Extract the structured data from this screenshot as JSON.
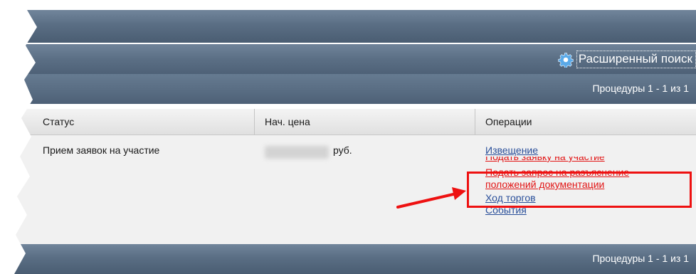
{
  "toolbar": {
    "advanced_search_label": "Расширенный поиск"
  },
  "pager": {
    "top_text": "Процедуры 1 - 1 из 1",
    "bottom_text": "Процедуры 1 - 1 из 1"
  },
  "table": {
    "columns": [
      "Статус",
      "Нач. цена",
      "Операции"
    ],
    "row": {
      "status": "Прием заявок на участие",
      "price_currency": "руб.",
      "operations": {
        "notice": "Извещение",
        "submit_application": "Подать заявку на участие",
        "clarification_request_line1": "Подать запрос на разъяснение",
        "clarification_request_line2": "положений документации",
        "auction_progress": "Ход торгов",
        "events": "События"
      }
    }
  },
  "icons": {
    "advanced_search": "gear-icon"
  },
  "colors": {
    "link_blue": "#2a4f9a",
    "link_red": "#e21515",
    "highlight": "#ee1111",
    "bar": "#5a6e84"
  }
}
